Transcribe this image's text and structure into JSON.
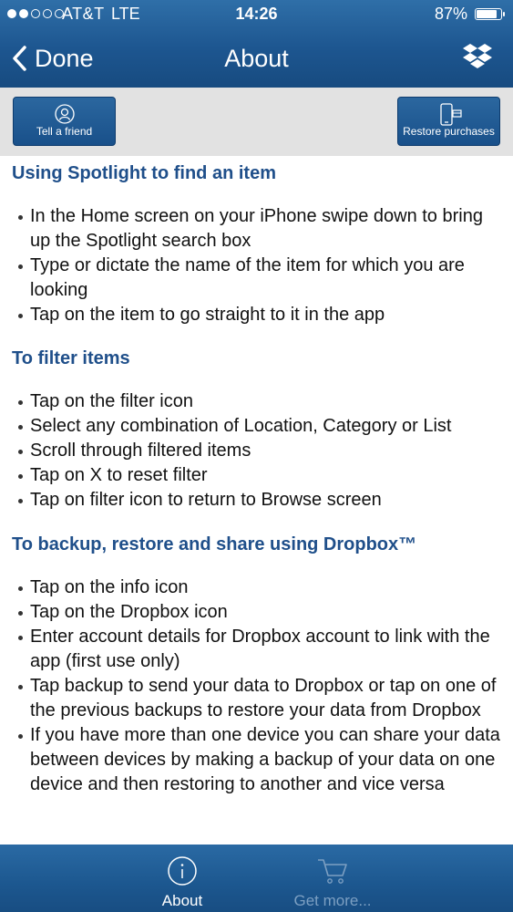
{
  "status_bar": {
    "carrier": "AT&T",
    "network": "LTE",
    "time": "14:26",
    "battery_percent": "87%",
    "battery_level": 0.87,
    "signal_bars_filled": 2,
    "signal_bars_total": 5
  },
  "nav": {
    "back_label": "Done",
    "title": "About",
    "right_icon": "dropbox-icon"
  },
  "buttons": {
    "tell_friend": {
      "label": "Tell a friend",
      "icon": "friend-icon"
    },
    "restore": {
      "label": "Restore purchases",
      "icon": "device-icon"
    }
  },
  "sections": [
    {
      "heading": "Using Spotlight to find an item",
      "items": [
        "In the Home screen on your iPhone swipe down to bring up the Spotlight search box",
        "Type or dictate the name of the item for which you are looking",
        "Tap on the item to go straight to it in the app"
      ]
    },
    {
      "heading": "To filter items",
      "items": [
        "Tap on the filter icon",
        "Select any combination of Location, Category or List",
        "Scroll through filtered items",
        "Tap on X to reset filter",
        "Tap on filter icon to return to Browse screen"
      ]
    },
    {
      "heading": "To backup, restore and share using Dropbox™",
      "items": [
        "Tap on the info icon",
        "Tap on the Dropbox icon",
        "Enter account details for Dropbox account to link with the app (first use only)",
        "Tap backup to send your data to Dropbox or tap on one of the previous backups to restore your data from Dropbox",
        "If you have more than one device you can share your data between devices by making a backup of your data on one device and then restoring to another and vice versa"
      ]
    }
  ],
  "tabbar": {
    "tabs": [
      {
        "label": "About",
        "icon": "info-icon",
        "active": true
      },
      {
        "label": "Get more...",
        "icon": "cart-icon",
        "active": false
      }
    ]
  },
  "colors": {
    "bar_blue": "#1d5690",
    "heading_blue": "#1f4f8a",
    "strip_gray": "#e2e2e2",
    "inactive_tab": "#7c9fc2"
  }
}
